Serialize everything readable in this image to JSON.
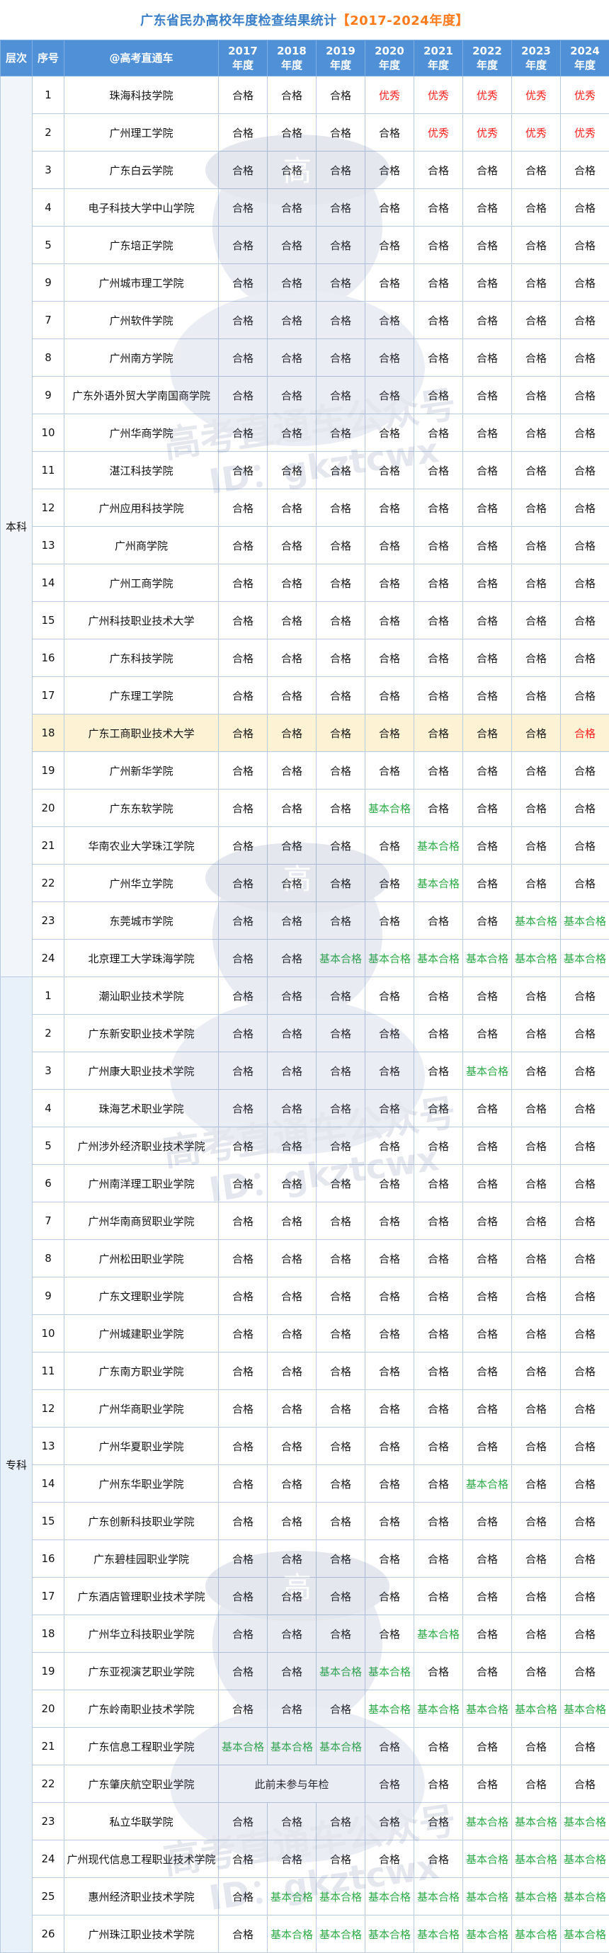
{
  "title": {
    "main": "广东省民办高校年度检查结果统计",
    "range": "【2017-2024年度】"
  },
  "header": {
    "level": "层次",
    "index": "序号",
    "name": "@高考直通车",
    "years": [
      {
        "year": "2017",
        "suffix": "年度"
      },
      {
        "year": "2018",
        "suffix": "年度"
      },
      {
        "year": "2019",
        "suffix": "年度"
      },
      {
        "year": "2020",
        "suffix": "年度"
      },
      {
        "year": "2021",
        "suffix": "年度"
      },
      {
        "year": "2022",
        "suffix": "年度"
      },
      {
        "year": "2023",
        "suffix": "年度"
      },
      {
        "year": "2024",
        "suffix": "年度"
      }
    ]
  },
  "status_colors": {
    "合格": "#1a1a1a",
    "优秀": "#ff2020",
    "基本合格": "#2eaa48"
  },
  "highlight_color": "#fdf3d4",
  "header_color": "#4f90d6",
  "title_color": "#3a7fc8",
  "watermark": {
    "line1": "高考直通车公众号",
    "line2": "ID：gkztcwx",
    "badge": "高"
  },
  "groups": [
    {
      "level": "本科",
      "rows": [
        {
          "idx": "1",
          "name": "珠海科技学院",
          "results": [
            "合格",
            "合格",
            "合格",
            "优秀",
            "优秀",
            "优秀",
            "优秀",
            "优秀"
          ]
        },
        {
          "idx": "2",
          "name": "广州理工学院",
          "results": [
            "合格",
            "合格",
            "合格",
            "合格",
            "优秀",
            "优秀",
            "优秀",
            "优秀"
          ]
        },
        {
          "idx": "3",
          "name": "广东白云学院",
          "results": [
            "合格",
            "合格",
            "合格",
            "合格",
            "合格",
            "合格",
            "合格",
            "合格"
          ]
        },
        {
          "idx": "4",
          "name": "电子科技大学中山学院",
          "results": [
            "合格",
            "合格",
            "合格",
            "合格",
            "合格",
            "合格",
            "合格",
            "合格"
          ]
        },
        {
          "idx": "5",
          "name": "广东培正学院",
          "results": [
            "合格",
            "合格",
            "合格",
            "合格",
            "合格",
            "合格",
            "合格",
            "合格"
          ]
        },
        {
          "idx": "9",
          "name": "广州城市理工学院",
          "results": [
            "合格",
            "合格",
            "合格",
            "合格",
            "合格",
            "合格",
            "合格",
            "合格"
          ]
        },
        {
          "idx": "7",
          "name": "广州软件学院",
          "results": [
            "合格",
            "合格",
            "合格",
            "合格",
            "合格",
            "合格",
            "合格",
            "合格"
          ]
        },
        {
          "idx": "8",
          "name": "广州南方学院",
          "results": [
            "合格",
            "合格",
            "合格",
            "合格",
            "合格",
            "合格",
            "合格",
            "合格"
          ]
        },
        {
          "idx": "9",
          "name": "广东外语外贸大学南国商学院",
          "results": [
            "合格",
            "合格",
            "合格",
            "合格",
            "合格",
            "合格",
            "合格",
            "合格"
          ]
        },
        {
          "idx": "10",
          "name": "广州华商学院",
          "results": [
            "合格",
            "合格",
            "合格",
            "合格",
            "合格",
            "合格",
            "合格",
            "合格"
          ]
        },
        {
          "idx": "11",
          "name": "湛江科技学院",
          "results": [
            "合格",
            "合格",
            "合格",
            "合格",
            "合格",
            "合格",
            "合格",
            "合格"
          ]
        },
        {
          "idx": "12",
          "name": "广州应用科技学院",
          "results": [
            "合格",
            "合格",
            "合格",
            "合格",
            "合格",
            "合格",
            "合格",
            "合格"
          ]
        },
        {
          "idx": "13",
          "name": "广州商学院",
          "results": [
            "合格",
            "合格",
            "合格",
            "合格",
            "合格",
            "合格",
            "合格",
            "合格"
          ]
        },
        {
          "idx": "14",
          "name": "广州工商学院",
          "results": [
            "合格",
            "合格",
            "合格",
            "合格",
            "合格",
            "合格",
            "合格",
            "合格"
          ]
        },
        {
          "idx": "15",
          "name": "广州科技职业技术大学",
          "results": [
            "合格",
            "合格",
            "合格",
            "合格",
            "合格",
            "合格",
            "合格",
            "合格"
          ]
        },
        {
          "idx": "16",
          "name": "广东科技学院",
          "results": [
            "合格",
            "合格",
            "合格",
            "合格",
            "合格",
            "合格",
            "合格",
            "合格"
          ]
        },
        {
          "idx": "17",
          "name": "广东理工学院",
          "results": [
            "合格",
            "合格",
            "合格",
            "合格",
            "合格",
            "合格",
            "合格",
            "合格"
          ]
        },
        {
          "idx": "18",
          "name": "广东工商职业技术大学",
          "results": [
            "合格",
            "合格",
            "合格",
            "合格",
            "合格",
            "合格",
            "合格",
            "合格"
          ],
          "highlight": true,
          "last_red": true
        },
        {
          "idx": "19",
          "name": "广州新华学院",
          "results": [
            "合格",
            "合格",
            "合格",
            "合格",
            "合格",
            "合格",
            "合格",
            "合格"
          ]
        },
        {
          "idx": "20",
          "name": "广东东软学院",
          "results": [
            "合格",
            "合格",
            "合格",
            "基本合格",
            "合格",
            "合格",
            "合格",
            "合格"
          ]
        },
        {
          "idx": "21",
          "name": "华南农业大学珠江学院",
          "results": [
            "合格",
            "合格",
            "合格",
            "合格",
            "基本合格",
            "合格",
            "合格",
            "合格"
          ]
        },
        {
          "idx": "22",
          "name": "广州华立学院",
          "results": [
            "合格",
            "合格",
            "合格",
            "合格",
            "基本合格",
            "合格",
            "合格",
            "合格"
          ]
        },
        {
          "idx": "23",
          "name": "东莞城市学院",
          "results": [
            "合格",
            "合格",
            "合格",
            "合格",
            "合格",
            "合格",
            "基本合格",
            "基本合格"
          ]
        },
        {
          "idx": "24",
          "name": "北京理工大学珠海学院",
          "results": [
            "合格",
            "合格",
            "基本合格",
            "基本合格",
            "基本合格",
            "基本合格",
            "基本合格",
            "基本合格"
          ]
        }
      ]
    },
    {
      "level": "专科",
      "rows": [
        {
          "idx": "1",
          "name": "潮汕职业技术学院",
          "results": [
            "合格",
            "合格",
            "合格",
            "合格",
            "合格",
            "合格",
            "合格",
            "合格"
          ]
        },
        {
          "idx": "2",
          "name": "广东新安职业技术学院",
          "results": [
            "合格",
            "合格",
            "合格",
            "合格",
            "合格",
            "合格",
            "合格",
            "合格"
          ]
        },
        {
          "idx": "3",
          "name": "广州康大职业技术学院",
          "results": [
            "合格",
            "合格",
            "合格",
            "合格",
            "合格",
            "基本合格",
            "合格",
            "合格"
          ]
        },
        {
          "idx": "4",
          "name": "珠海艺术职业学院",
          "results": [
            "合格",
            "合格",
            "合格",
            "合格",
            "合格",
            "合格",
            "合格",
            "合格"
          ]
        },
        {
          "idx": "5",
          "name": "广州涉外经济职业技术学院",
          "results": [
            "合格",
            "合格",
            "合格",
            "合格",
            "合格",
            "合格",
            "合格",
            "合格"
          ]
        },
        {
          "idx": "6",
          "name": "广州南洋理工职业学院",
          "results": [
            "合格",
            "合格",
            "合格",
            "合格",
            "合格",
            "合格",
            "合格",
            "合格"
          ]
        },
        {
          "idx": "7",
          "name": "广州华南商贸职业学院",
          "results": [
            "合格",
            "合格",
            "合格",
            "合格",
            "合格",
            "合格",
            "合格",
            "合格"
          ]
        },
        {
          "idx": "8",
          "name": "广州松田职业学院",
          "results": [
            "合格",
            "合格",
            "合格",
            "合格",
            "合格",
            "合格",
            "合格",
            "合格"
          ]
        },
        {
          "idx": "9",
          "name": "广东文理职业学院",
          "results": [
            "合格",
            "合格",
            "合格",
            "合格",
            "合格",
            "合格",
            "合格",
            "合格"
          ]
        },
        {
          "idx": "10",
          "name": "广州城建职业学院",
          "results": [
            "合格",
            "合格",
            "合格",
            "合格",
            "合格",
            "合格",
            "合格",
            "合格"
          ]
        },
        {
          "idx": "11",
          "name": "广东南方职业学院",
          "results": [
            "合格",
            "合格",
            "合格",
            "合格",
            "合格",
            "合格",
            "合格",
            "合格"
          ]
        },
        {
          "idx": "12",
          "name": "广州华商职业学院",
          "results": [
            "合格",
            "合格",
            "合格",
            "合格",
            "合格",
            "合格",
            "合格",
            "合格"
          ]
        },
        {
          "idx": "13",
          "name": "广州华夏职业学院",
          "results": [
            "合格",
            "合格",
            "合格",
            "合格",
            "合格",
            "合格",
            "合格",
            "合格"
          ]
        },
        {
          "idx": "14",
          "name": "广州东华职业学院",
          "results": [
            "合格",
            "合格",
            "合格",
            "合格",
            "合格",
            "基本合格",
            "合格",
            "合格"
          ]
        },
        {
          "idx": "15",
          "name": "广东创新科技职业学院",
          "results": [
            "合格",
            "合格",
            "合格",
            "合格",
            "合格",
            "合格",
            "合格",
            "合格"
          ]
        },
        {
          "idx": "16",
          "name": "广东碧桂园职业学院",
          "results": [
            "合格",
            "合格",
            "合格",
            "合格",
            "合格",
            "合格",
            "合格",
            "合格"
          ]
        },
        {
          "idx": "17",
          "name": "广东酒店管理职业技术学院",
          "results": [
            "合格",
            "合格",
            "合格",
            "合格",
            "合格",
            "合格",
            "合格",
            "合格"
          ]
        },
        {
          "idx": "18",
          "name": "广州华立科技职业学院",
          "results": [
            "合格",
            "合格",
            "合格",
            "合格",
            "基本合格",
            "合格",
            "合格",
            "合格"
          ]
        },
        {
          "idx": "19",
          "name": "广东亚视演艺职业学院",
          "results": [
            "合格",
            "合格",
            "基本合格",
            "基本合格",
            "合格",
            "合格",
            "合格",
            "合格"
          ]
        },
        {
          "idx": "20",
          "name": "广东岭南职业技术学院",
          "results": [
            "合格",
            "合格",
            "合格",
            "基本合格",
            "基本合格",
            "基本合格",
            "基本合格",
            "基本合格"
          ]
        },
        {
          "idx": "21",
          "name": "广东信息工程职业学院",
          "results": [
            "基本合格",
            "基本合格",
            "基本合格",
            "合格",
            "合格",
            "合格",
            "合格",
            "合格"
          ]
        },
        {
          "idx": "22",
          "name": "广东肇庆航空职业学院",
          "note": "此前未参与年检",
          "note_span": 3,
          "results": [
            "合格",
            "合格",
            "合格",
            "合格",
            "合格"
          ]
        },
        {
          "idx": "23",
          "name": "私立华联学院",
          "results": [
            "合格",
            "合格",
            "合格",
            "合格",
            "合格",
            "基本合格",
            "基本合格",
            "基本合格"
          ]
        },
        {
          "idx": "24",
          "name": "广州现代信息工程职业技术学院",
          "results": [
            "合格",
            "合格",
            "合格",
            "合格",
            "合格",
            "基本合格",
            "基本合格",
            "基本合格"
          ]
        },
        {
          "idx": "25",
          "name": "惠州经济职业技术学院",
          "results": [
            "合格",
            "基本合格",
            "基本合格",
            "基本合格",
            "基本合格",
            "基本合格",
            "基本合格",
            "基本合格"
          ]
        },
        {
          "idx": "26",
          "name": "广州珠江职业技术学院",
          "results": [
            "合格",
            "基本合格",
            "基本合格",
            "基本合格",
            "基本合格",
            "基本合格",
            "基本合格",
            "基本合格"
          ]
        }
      ]
    }
  ]
}
